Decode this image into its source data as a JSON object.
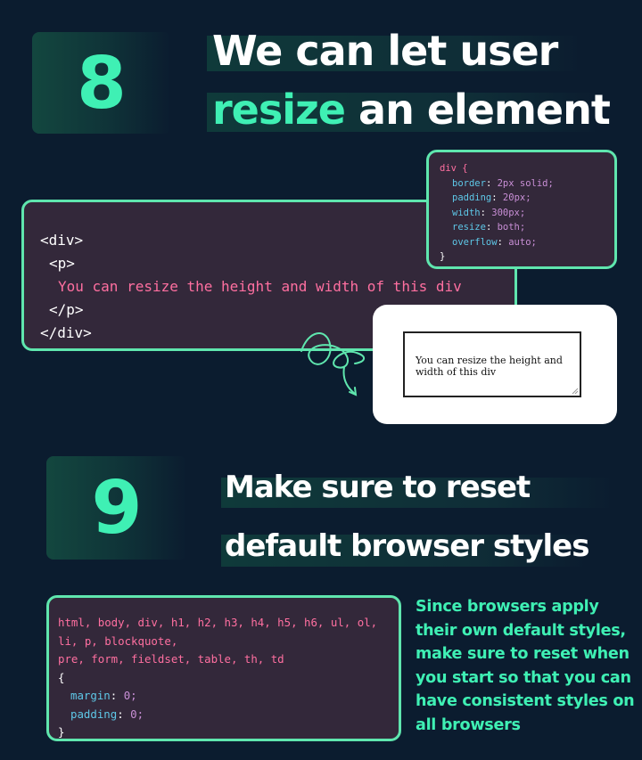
{
  "tip8": {
    "number": "8",
    "title_line1": "We can let user",
    "title_accent": "resize",
    "title_rest": " an element",
    "html_code": [
      "<div>",
      "<p>",
      "You can resize the height and width of this div",
      "</p>",
      "</div>"
    ],
    "css_code": {
      "open": "div {",
      "close": "}",
      "rules": [
        {
          "prop": "border",
          "val": "2px solid;"
        },
        {
          "prop": "padding",
          "val": "20px;"
        },
        {
          "prop": "width",
          "val": "300px;"
        },
        {
          "prop": "resize",
          "val": "both;"
        },
        {
          "prop": "overflow",
          "val": "auto;"
        }
      ]
    },
    "demo_text": "You can resize the height and width of this div"
  },
  "tip9": {
    "number": "9",
    "title_line1": "Make sure to reset",
    "title_line2": "default browser styles",
    "selector_lines": [
      "html, body, div, h1, h2, h3, h4, h5, h6, ul, ol,",
      "li, p, blockquote,",
      "pre, form, fieldset, table, th, td"
    ],
    "open": "{",
    "rules": [
      {
        "prop": "margin",
        "val": "0;"
      },
      {
        "prop": "padding",
        "val": "0;"
      }
    ],
    "close": "}",
    "description": "Since browsers apply their own default styles, make sure to reset when you start so that you can have consistent styles on all browsers"
  },
  "colors": {
    "background": "#0b1c2f",
    "accent": "#3ff0b4",
    "code_bg": "#33283a",
    "code_border": "#5fe6ae",
    "tag_pink": "#ff6fa0",
    "prop_blue": "#5ec8e8",
    "val_purple": "#c98fd6"
  }
}
